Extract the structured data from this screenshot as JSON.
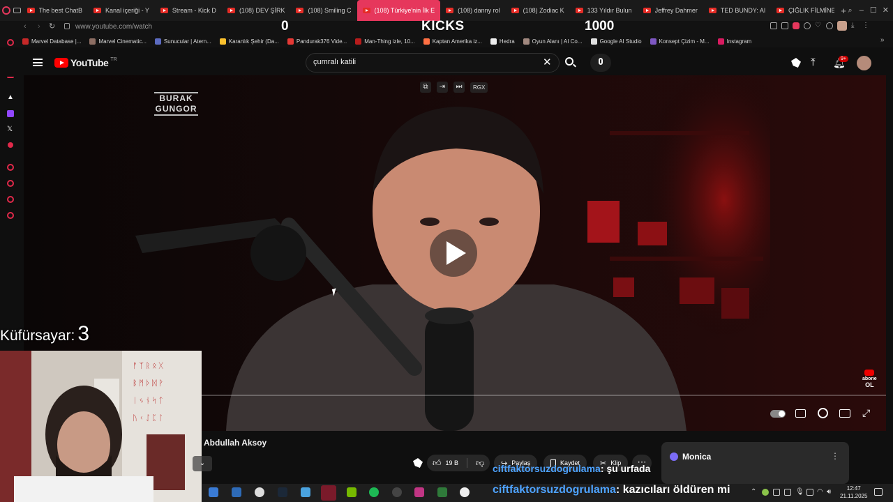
{
  "browser": {
    "tabs": [
      {
        "label": "The best ChatB",
        "active": false
      },
      {
        "label": "Kanal içeriği - Y",
        "active": false
      },
      {
        "label": "Stream - Kick D",
        "active": false
      },
      {
        "label": "(108) DEV ŞİRK",
        "active": false
      },
      {
        "label": "(108) Smiling C",
        "active": false
      },
      {
        "label": "(108) Türkiye'nin İlk E",
        "active": true
      },
      {
        "label": "(108) danny rol",
        "active": false
      },
      {
        "label": "(108) Zodiac K",
        "active": false
      },
      {
        "label": "133 Yıldır Bulun",
        "active": false
      },
      {
        "label": "Jeffrey Dahmer",
        "active": false
      },
      {
        "label": "TED BUNDY: Al",
        "active": false
      },
      {
        "label": "ÇIĞLIK FİLMİNE",
        "active": false
      }
    ],
    "url": "www.youtube.com/watch",
    "bookmarks": [
      {
        "label": "Marvel Database |...",
        "color": "#c62828"
      },
      {
        "label": "Marvel Cinematic...",
        "color": "#8d6e63"
      },
      {
        "label": "Sunucular | Atern...",
        "color": "#5c6bc0"
      },
      {
        "label": "Karanlık Şehir (Da...",
        "color": "#fbc02d"
      },
      {
        "label": "Pandurak376 Vide...",
        "color": "#e53935"
      },
      {
        "label": "Man-Thing izle, 10...",
        "color": "#b71c1c"
      },
      {
        "label": "Kaptan Amerika iz...",
        "color": "#ff7043"
      },
      {
        "label": "Hedra",
        "color": "#eeeeee"
      },
      {
        "label": "Oyun Alanı | AI Co...",
        "color": "#a1887f"
      },
      {
        "label": "Google AI Studio",
        "color": "#e0e0e0"
      },
      {
        "label": "Konsept Çizim - M...",
        "color": "#7e57c2"
      },
      {
        "label": "Instagram",
        "color": "#d81b60"
      }
    ]
  },
  "overlay": {
    "left_counter": "0",
    "center_title": "KICKS",
    "right_counter": "1000",
    "swear_label": "Küfürsayar:",
    "swear_count": "3",
    "chat": [
      {
        "user": "ciftfaktorsuzdogrulama",
        "message": ": şu urfada"
      },
      {
        "user": "ciftfaktorsuzdogrulama",
        "message": ": kazıcıları öldüren mi"
      }
    ]
  },
  "youtube": {
    "logo": "YouTube",
    "region": "TR",
    "search_query": "çumralı katili",
    "notifications_badge": "9+",
    "watermark_line1": "BURAK",
    "watermark_line2": "GUNGOR",
    "corner_badge_line1": "abone",
    "corner_badge_line2": "OL",
    "player_top_label": "RGX",
    "channel_name": "Abdullah Aksoy",
    "likes": "19 B",
    "share_label": "Paylaş",
    "save_label": "Kaydet",
    "clip_label": "Klip",
    "monica_label": "Monica"
  },
  "taskbar": {
    "time": "12:47",
    "date": "21.11.2025"
  },
  "colors": {
    "accent": "#e6375c",
    "yt_red": "#ff0000",
    "bg": "#0f0f0f"
  }
}
